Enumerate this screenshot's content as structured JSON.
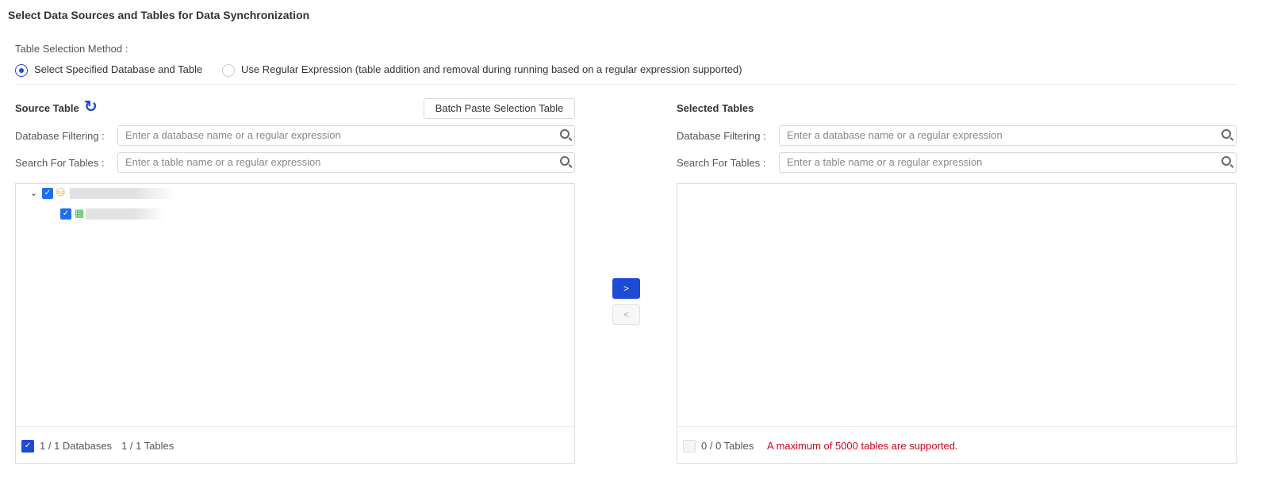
{
  "title": "Select Data Sources and Tables for Data Synchronization",
  "method": {
    "label": "Table Selection Method :",
    "options": [
      "Select Specified Database and Table",
      "Use Regular Expression (table addition and removal during running based on a regular expression supported)"
    ],
    "selected": 0
  },
  "source": {
    "title": "Source Table",
    "batch_button": "Batch Paste Selection Table",
    "db_filter_label": "Database Filtering :",
    "db_filter_placeholder": "Enter a database name or a regular expression",
    "table_search_label": "Search For Tables :",
    "table_search_placeholder": "Enter a table name or a regular expression",
    "footer_dbs": "1 / 1 Databases",
    "footer_tables": "1 / 1 Tables"
  },
  "transfer": {
    "right": ">",
    "left": "<"
  },
  "selected": {
    "title": "Selected Tables",
    "db_filter_label": "Database Filtering :",
    "db_filter_placeholder": "Enter a database name or a regular expression",
    "table_search_label": "Search For Tables :",
    "table_search_placeholder": "Enter a table name or a regular expression",
    "footer_tables": "0 / 0 Tables",
    "warning": "A maximum of 5000 tables are supported."
  },
  "colors": {
    "accent": "#1e4bd6",
    "warning": "#d0021b"
  }
}
